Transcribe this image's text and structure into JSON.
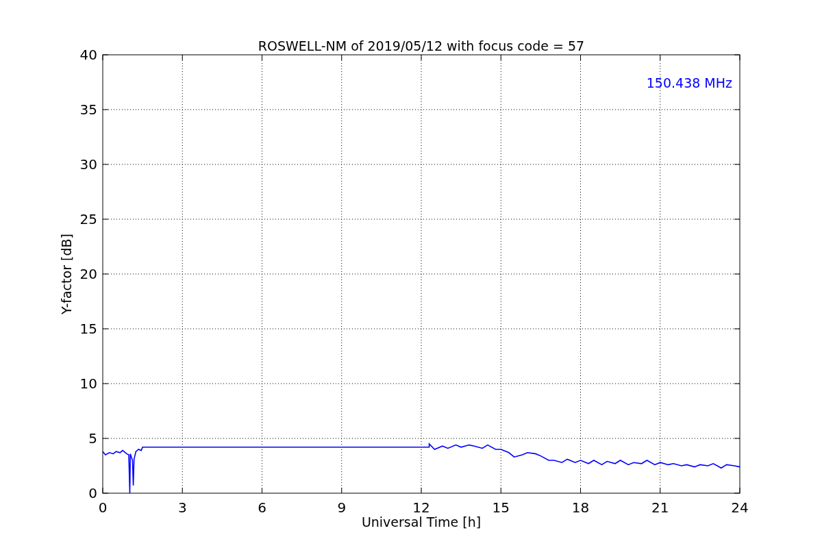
{
  "chart_data": {
    "type": "line",
    "title": "ROSWELL-NM of 2019/05/12 with focus code = 57",
    "xlabel": "Universal Time [h]",
    "ylabel": "Y-factor [dB]",
    "xlim": [
      0,
      24
    ],
    "ylim": [
      0,
      40
    ],
    "grid": true,
    "xticks": [
      0,
      3,
      6,
      9,
      12,
      15,
      18,
      21,
      24
    ],
    "yticks": [
      0,
      5,
      10,
      15,
      20,
      25,
      30,
      35,
      40
    ],
    "x": [
      0,
      0.1,
      0.25,
      0.4,
      0.5,
      0.65,
      0.75,
      0.9,
      0.98,
      1.02,
      1.04,
      1.08,
      1.12,
      1.15,
      1.18,
      1.25,
      1.35,
      1.45,
      1.5,
      12.3,
      12.3,
      12.5,
      12.8,
      13,
      13.3,
      13.5,
      13.8,
      14,
      14.3,
      14.5,
      14.8,
      15,
      15.3,
      15.5,
      15.8,
      16,
      16.3,
      16.5,
      16.8,
      17,
      17.3,
      17.5,
      17.8,
      18,
      18.3,
      18.5,
      18.8,
      19,
      19.3,
      19.5,
      19.8,
      20,
      20.3,
      20.5,
      20.8,
      21,
      21.3,
      21.5,
      21.8,
      22,
      22.3,
      22.5,
      22.8,
      23,
      23.3,
      23.5,
      23.8,
      24
    ],
    "series": [
      {
        "name": "150.438 MHz",
        "color": "#0000ff",
        "values": [
          3.8,
          3.5,
          3.7,
          3.6,
          3.8,
          3.7,
          3.9,
          3.6,
          3.5,
          0,
          3.6,
          3.3,
          3.0,
          0.7,
          3.1,
          3.8,
          4.0,
          3.9,
          4.2,
          4.2,
          4.5,
          4.0,
          4.3,
          4.1,
          4.4,
          4.2,
          4.4,
          4.3,
          4.1,
          4.4,
          4.0,
          4.0,
          3.7,
          3.3,
          3.5,
          3.7,
          3.6,
          3.4,
          3.0,
          3.0,
          2.8,
          3.1,
          2.8,
          3.0,
          2.7,
          3.0,
          2.6,
          2.9,
          2.7,
          3.0,
          2.6,
          2.8,
          2.7,
          3.0,
          2.6,
          2.8,
          2.6,
          2.7,
          2.5,
          2.6,
          2.4,
          2.6,
          2.5,
          2.7,
          2.3,
          2.6,
          2.5,
          2.4
        ]
      }
    ]
  }
}
